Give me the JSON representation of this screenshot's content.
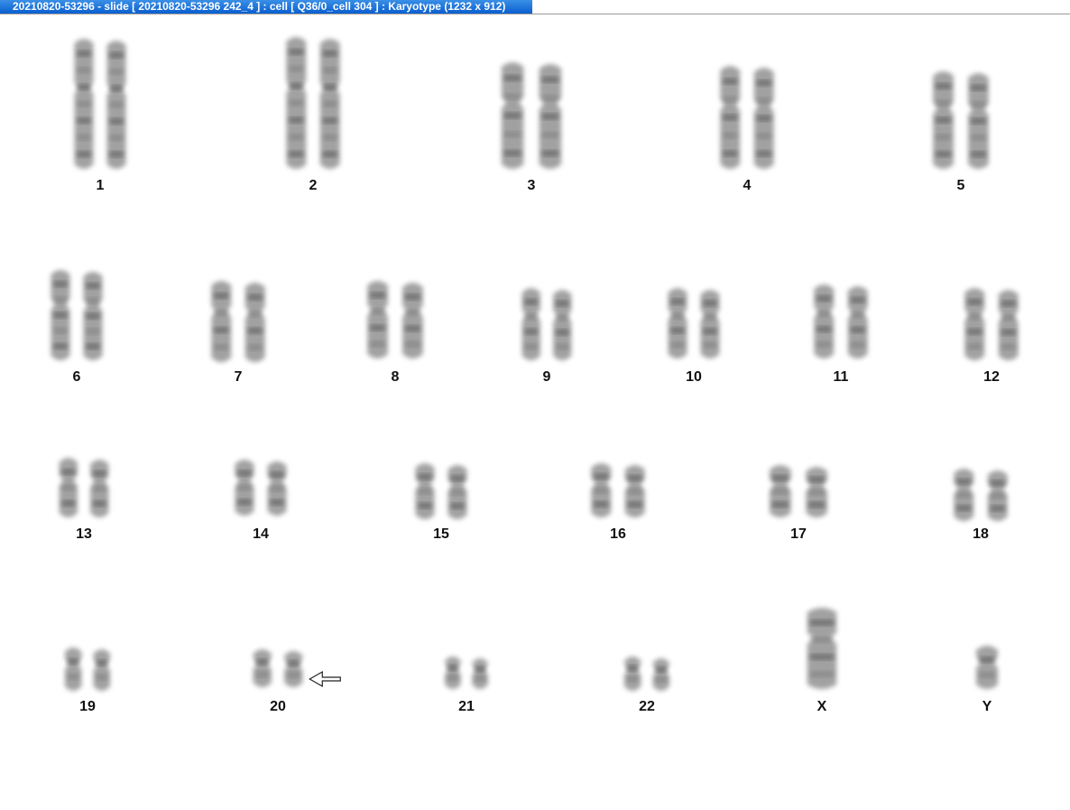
{
  "window": {
    "title": "20210820-53296 - slide [ 20210820-53296 242_4 ] : cell [ Q36/0_cell 304 ] : Karyotype  (1232 x 912)"
  },
  "karyotype": {
    "rows": [
      {
        "chromosomes": [
          {
            "label": "1",
            "count": 2
          },
          {
            "label": "2",
            "count": 2
          },
          {
            "label": "3",
            "count": 2
          },
          {
            "label": "4",
            "count": 2
          },
          {
            "label": "5",
            "count": 2
          }
        ]
      },
      {
        "chromosomes": [
          {
            "label": "6",
            "count": 2
          },
          {
            "label": "7",
            "count": 2
          },
          {
            "label": "8",
            "count": 2
          },
          {
            "label": "9",
            "count": 2
          },
          {
            "label": "10",
            "count": 2
          },
          {
            "label": "11",
            "count": 2
          },
          {
            "label": "12",
            "count": 2
          }
        ]
      },
      {
        "chromosomes": [
          {
            "label": "13",
            "count": 2
          },
          {
            "label": "14",
            "count": 2
          },
          {
            "label": "15",
            "count": 2
          },
          {
            "label": "16",
            "count": 2
          },
          {
            "label": "17",
            "count": 2
          },
          {
            "label": "18",
            "count": 2
          }
        ]
      },
      {
        "chromosomes": [
          {
            "label": "19",
            "count": 2
          },
          {
            "label": "20",
            "count": 2,
            "marked": true
          },
          {
            "label": "21",
            "count": 2
          },
          {
            "label": "22",
            "count": 2
          },
          {
            "label": "X",
            "count": 1
          },
          {
            "label": "Y",
            "count": 1
          }
        ]
      }
    ],
    "marker": {
      "icon": "left-arrow-icon",
      "target": "20"
    },
    "colors": {
      "chromosome": "#555555",
      "background": "#ffffff"
    }
  }
}
